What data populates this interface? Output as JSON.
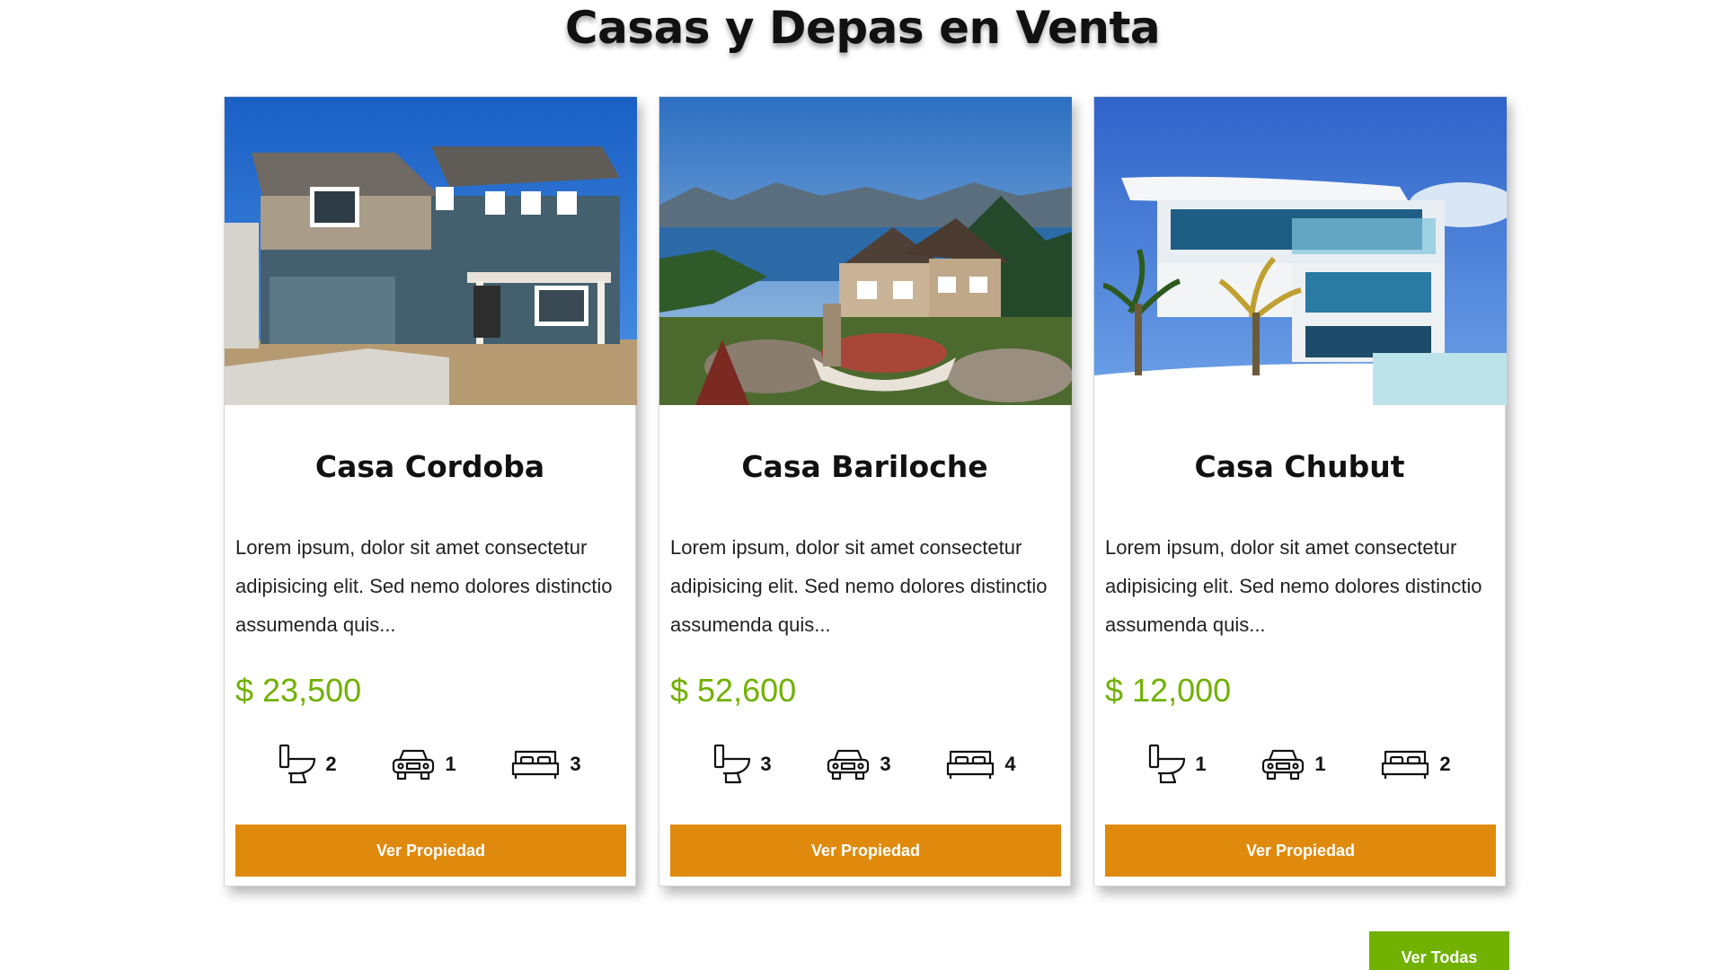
{
  "page": {
    "title": "Casas y Depas en Venta"
  },
  "colors": {
    "price": "#71b100",
    "card_button": "#e08a0d",
    "all_button": "#71b100"
  },
  "listings": [
    {
      "title": "Casa Cordoba",
      "description": "Lorem ipsum, dolor sit amet consectetur adipisicing elit. Sed nemo dolores distinctio assumenda quis...",
      "price": "$ 23,500",
      "bathrooms": "2",
      "parking": "1",
      "bedrooms": "3",
      "button_label": "Ver Propiedad"
    },
    {
      "title": "Casa Bariloche",
      "description": "Lorem ipsum, dolor sit amet consectetur adipisicing elit. Sed nemo dolores distinctio assumenda quis...",
      "price": "$ 52,600",
      "bathrooms": "3",
      "parking": "3",
      "bedrooms": "4",
      "button_label": "Ver Propiedad"
    },
    {
      "title": "Casa Chubut",
      "description": "Lorem ipsum, dolor sit amet consectetur adipisicing elit. Sed nemo dolores distinctio assumenda quis...",
      "price": "$ 12,000",
      "bathrooms": "1",
      "parking": "1",
      "bedrooms": "2",
      "button_label": "Ver Propiedad"
    }
  ],
  "icons": {
    "bathroom": "toilet-icon",
    "parking": "car-icon",
    "bedroom": "bed-icon"
  },
  "footer": {
    "all_button_label": "Ver Todas"
  }
}
